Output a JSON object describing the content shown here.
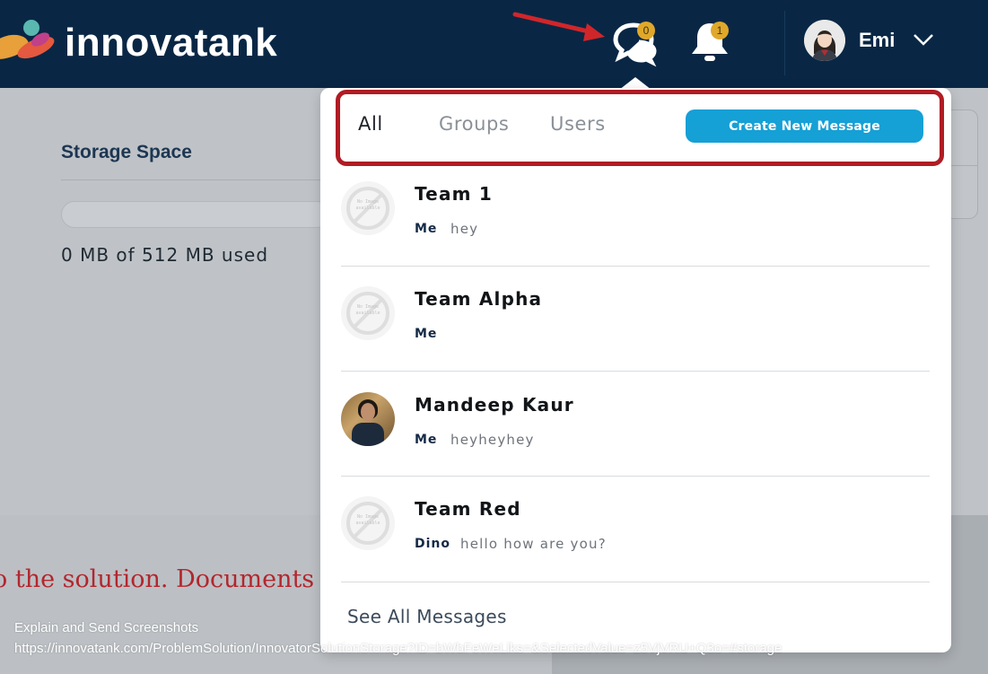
{
  "header": {
    "logo_text": "innovatank",
    "messages_badge": "0",
    "notifications_badge": "1",
    "user_name": "Emi"
  },
  "storage": {
    "title": "Storage Space",
    "used_text": "0 MB of 512 MB used",
    "used_fraction": 0
  },
  "background": {
    "solution_text": "o the solution. Documents in"
  },
  "messages_dropdown": {
    "tabs": [
      {
        "label": "All",
        "active": true
      },
      {
        "label": "Groups",
        "active": false
      },
      {
        "label": "Users",
        "active": false
      }
    ],
    "create_button": "Create New Message",
    "no_image_text": "No Image available",
    "conversations": [
      {
        "name": "Team 1",
        "sender": "Me",
        "message": "hey",
        "avatar": "no-image"
      },
      {
        "name": "Team Alpha",
        "sender": "Me",
        "message": "",
        "avatar": "no-image"
      },
      {
        "name": "Mandeep Kaur",
        "sender": "Me",
        "message": "heyheyhey",
        "avatar": "photo"
      },
      {
        "name": "Team Red",
        "sender": "Dino",
        "message": "hello how are you?",
        "avatar": "no-image"
      }
    ],
    "see_all": "See All Messages"
  },
  "overlay": {
    "caption": "Explain and Send Screenshots",
    "url": "https://innovatank.com/ProblemSolution/InnovatorSolutionStorage?ID=bWbFeWeLiks=&SelectedValue=z5VjVRU+Q3o=#storage"
  },
  "colors": {
    "header_bg": "#092745",
    "accent_blue": "#15a0d6",
    "badge_yellow": "#e0a82a",
    "highlight_red": "#b01c24",
    "arrow_red": "#d0262a"
  }
}
